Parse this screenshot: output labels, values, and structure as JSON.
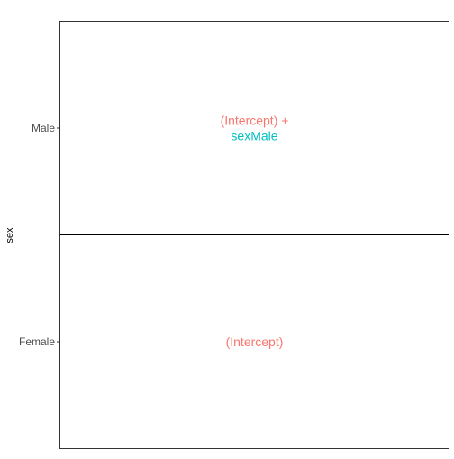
{
  "chart_data": {
    "type": "table",
    "ylabel": "sex",
    "xlabel": "",
    "categories": [
      "Female",
      "Male"
    ],
    "divider_after": "Female",
    "cells": [
      {
        "category": "Female",
        "terms": [
          {
            "text": "(Intercept)",
            "color": "#F8766D"
          }
        ]
      },
      {
        "category": "Male",
        "terms": [
          {
            "text": "(Intercept) +",
            "color": "#F8766D"
          },
          {
            "text": "sexMale",
            "color": "#00BFC4"
          }
        ]
      }
    ],
    "grid": false,
    "panel_border_color": "#333333",
    "tick_label_color": "#4D4D4D"
  }
}
